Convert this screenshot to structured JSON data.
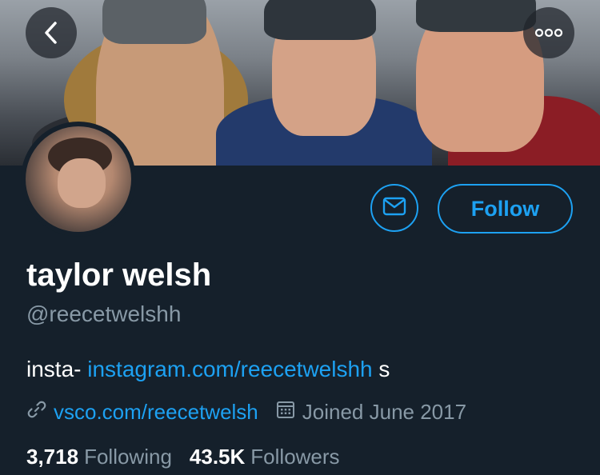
{
  "profile": {
    "name": "taylor welsh",
    "handle": "@reecetwelshh",
    "bio_prefix": "insta- ",
    "bio_link": "instagram.com/reecetwelshh",
    "bio_suffix": " s",
    "website": "vsco.com/reecetwelsh",
    "joined": "Joined June 2017"
  },
  "actions": {
    "follow_label": "Follow",
    "message_icon": "envelope-icon",
    "back_icon": "chevron-left-icon",
    "more_icon": "more-horizontal-icon"
  },
  "stats": {
    "following_count": "3,718",
    "following_label": "Following",
    "followers_count": "43.5K",
    "followers_label": "Followers"
  },
  "colors": {
    "background": "#15202b",
    "accent": "#1da1f2",
    "secondary_text": "#8899a6",
    "primary_text": "#ffffff"
  }
}
